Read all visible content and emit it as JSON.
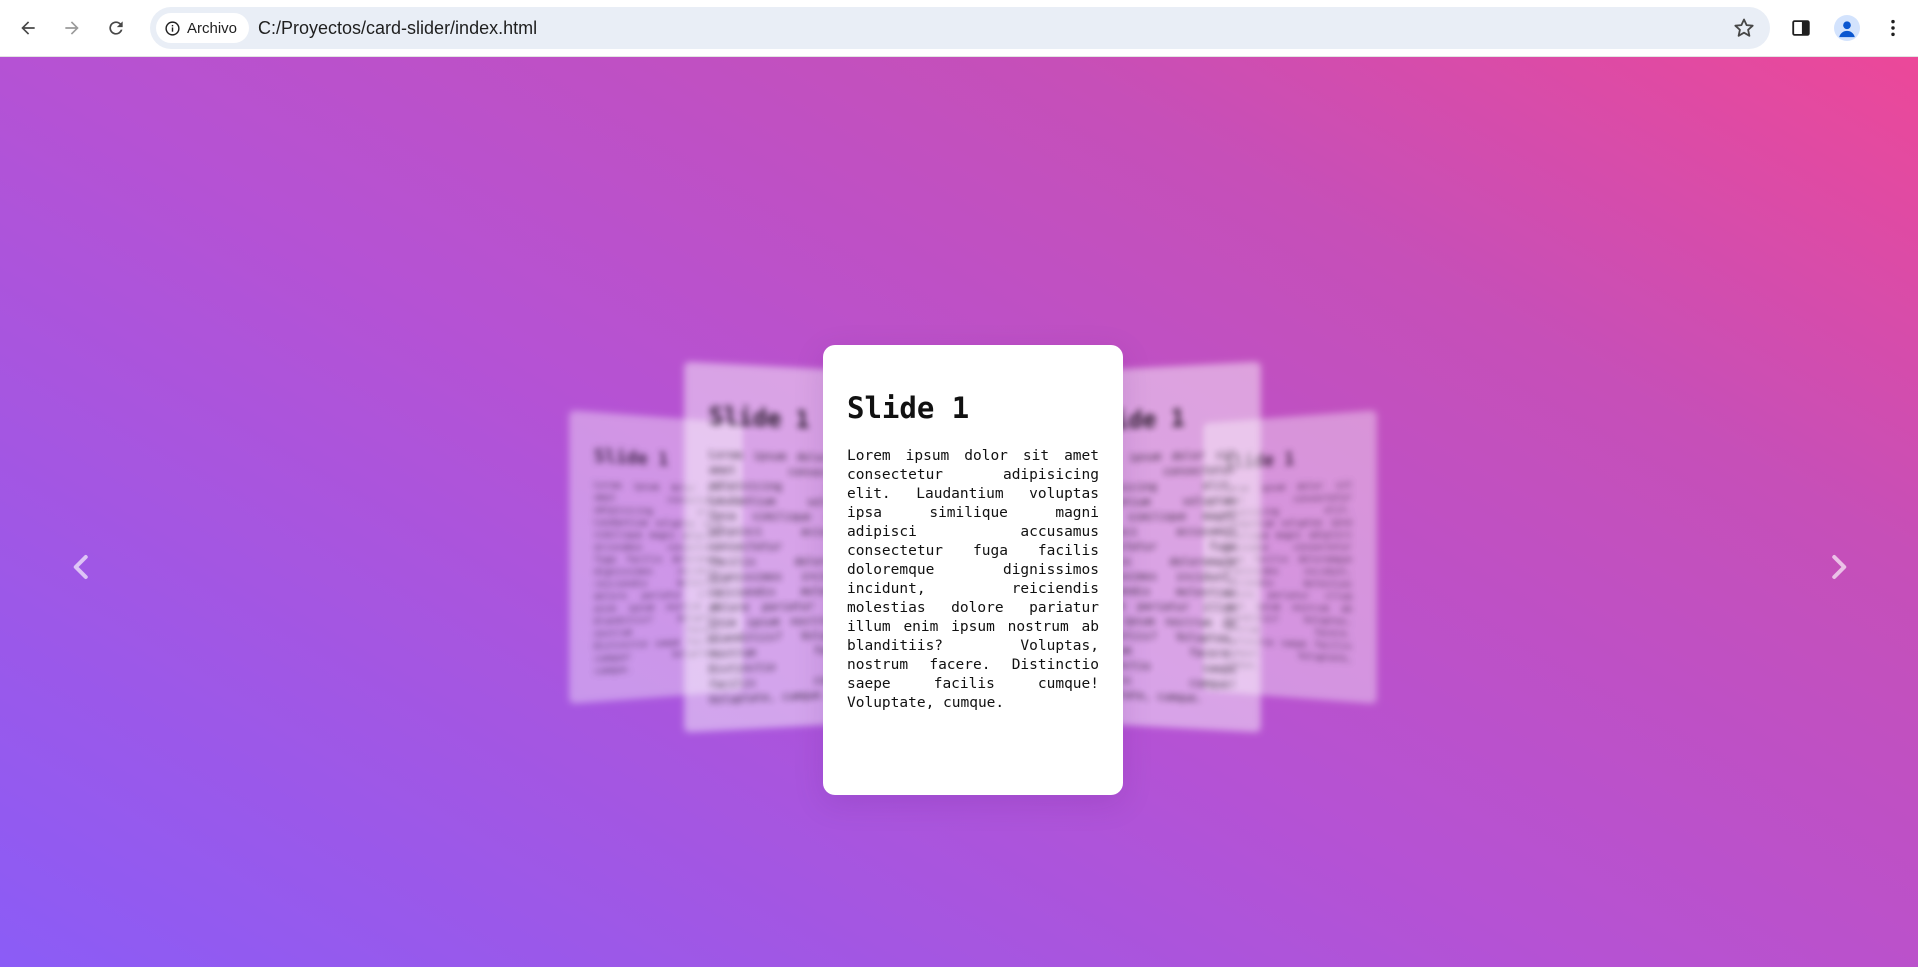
{
  "browser": {
    "security_label": "Archivo",
    "url": "C:/Proyectos/card-slider/index.html",
    "icons": {
      "back": "arrow-left-icon",
      "forward": "arrow-right-icon",
      "reload": "reload-icon",
      "info": "info-icon",
      "bookmark": "star-icon",
      "side_panel": "side-panel-icon",
      "profile": "profile-icon",
      "menu": "kebab-menu-icon"
    }
  },
  "slider": {
    "prev_icon": "chevron-left-icon",
    "next_icon": "chevron-right-icon",
    "active_slide": {
      "title": "Slide 1",
      "text": "Lorem ipsum dolor sit amet consectetur adipisicing elit. Laudantium voluptas ipsa similique magni adipisci accusamus consectetur fuga facilis doloremque dignissimos incidunt, reiciendis molestias dolore pariatur illum enim ipsum nostrum ab blanditiis? Voluptas, nostrum facere. Distinctio saepe facilis cumque! Voluptate, cumque."
    },
    "background_colors": [
      "#8b5cf6",
      "#b552d4",
      "#c64fb8",
      "#ec4899"
    ]
  }
}
